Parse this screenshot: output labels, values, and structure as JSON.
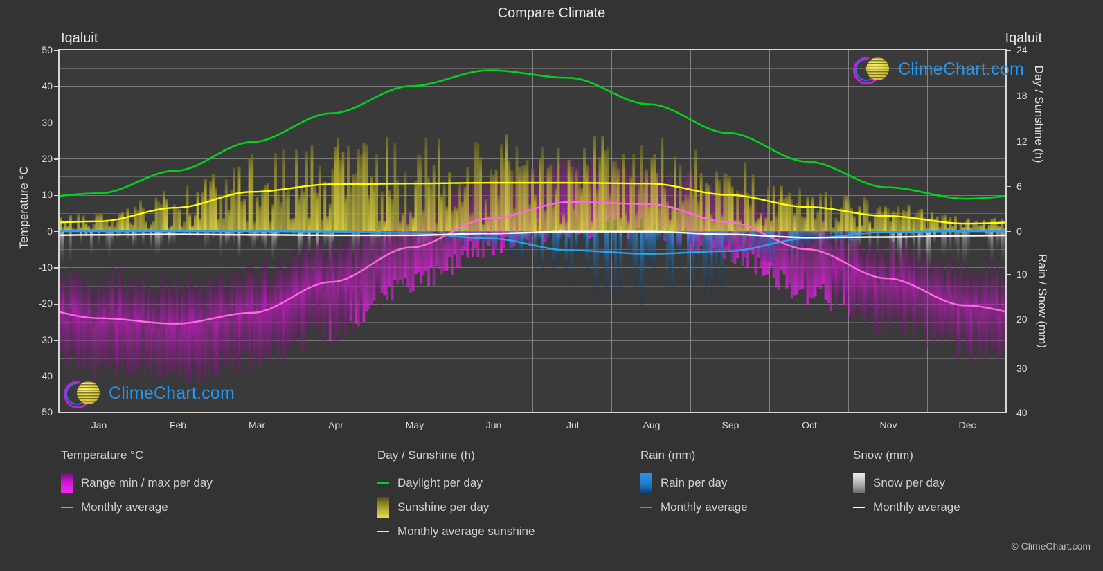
{
  "title": "Compare Climate",
  "city_left": "Iqaluit",
  "city_right": "Iqaluit",
  "logo_text": "ClimeChart.com",
  "copyright": "© ClimeChart.com",
  "axes": {
    "left_label": "Temperature °C",
    "right_label_top": "Day / Sunshine (h)",
    "right_label_bottom": "Rain / Snow (mm)",
    "left_ticks": [
      "50",
      "40",
      "30",
      "20",
      "10",
      "0",
      "-10",
      "-20",
      "-30",
      "-40",
      "-50"
    ],
    "right_ticks_top": [
      "24",
      "18",
      "12",
      "6",
      "0"
    ],
    "right_ticks_bottom": [
      "10",
      "20",
      "30",
      "40"
    ],
    "x_ticks": [
      "Jan",
      "Feb",
      "Mar",
      "Apr",
      "May",
      "Jun",
      "Jul",
      "Aug",
      "Sep",
      "Oct",
      "Nov",
      "Dec"
    ]
  },
  "colors": {
    "background": "#333333",
    "plot_background": "#3a3a3a",
    "grid": "#8d8d8d",
    "temperature_range": "#e000e0",
    "temperature_avg": "#ff6ae0",
    "daylight": "#00d21e",
    "sunshine_bars": "#d4cc33",
    "sunshine_avg": "#ffff00",
    "rain_bars": "#1a7fd4",
    "rain_avg": "#29a3f0",
    "snow_bars": "#bfbfbf",
    "snow_avg": "#ffffff",
    "logo_blue": "#2196f3"
  },
  "legend": {
    "temperature": {
      "heading": "Temperature °C",
      "items": [
        {
          "label": "Range min / max per day",
          "swatch": "gradient",
          "color": "#e000e0"
        },
        {
          "label": "Monthly average",
          "swatch": "line",
          "color": "#ff6ae0"
        }
      ]
    },
    "daysun": {
      "heading": "Day / Sunshine (h)",
      "items": [
        {
          "label": "Daylight per day",
          "swatch": "line",
          "color": "#00d21e"
        },
        {
          "label": "Sunshine per day",
          "swatch": "gradient",
          "color": "#d4cc33"
        },
        {
          "label": "Monthly average sunshine",
          "swatch": "line",
          "color": "#ffff00"
        }
      ]
    },
    "rain": {
      "heading": "Rain (mm)",
      "items": [
        {
          "label": "Rain per day",
          "swatch": "gradient",
          "color": "#1a7fd4"
        },
        {
          "label": "Monthly average",
          "swatch": "line",
          "color": "#29a3f0"
        }
      ]
    },
    "snow": {
      "heading": "Snow (mm)",
      "items": [
        {
          "label": "Snow per day",
          "swatch": "gradient",
          "color": "#bfbfbf"
        },
        {
          "label": "Monthly average",
          "swatch": "line",
          "color": "#ffffff"
        }
      ]
    }
  },
  "chart_data": {
    "type": "line",
    "title": "Compare Climate",
    "location": "Iqaluit",
    "xlabel": "",
    "ylabel": "Temperature °C",
    "ylim": [
      -50,
      50
    ],
    "y2lim_top": [
      0,
      24
    ],
    "y2lim_bottom": [
      0,
      40
    ],
    "grid": true,
    "legend_position": "bottom",
    "categories": [
      "Jan",
      "Feb",
      "Mar",
      "Apr",
      "May",
      "Jun",
      "Jul",
      "Aug",
      "Sep",
      "Oct",
      "Nov",
      "Dec"
    ],
    "series": [
      {
        "name": "Monthly average temperature (°C)",
        "color": "#ff6ae0",
        "unit": "°C",
        "values": [
          -24.0,
          -25.5,
          -22.5,
          -14.0,
          -4.5,
          3.5,
          8.0,
          7.5,
          2.5,
          -5.0,
          -13.0,
          -20.5
        ]
      },
      {
        "name": "Daily temperature range min/max (°C)",
        "color": "#e000e0",
        "unit": "°C",
        "min_values": [
          -38,
          -40,
          -36,
          -28,
          -14,
          -4,
          1,
          1,
          -6,
          -17,
          -26,
          -33
        ],
        "max_values": [
          -13,
          -15,
          -11,
          -3,
          5,
          13,
          17,
          16,
          10,
          2,
          -5,
          -10
        ]
      },
      {
        "name": "Daylight per day (h)",
        "color": "#00d21e",
        "unit": "h",
        "axis": "right-top",
        "values": [
          5.0,
          8.0,
          11.8,
          15.6,
          19.2,
          21.3,
          20.3,
          16.8,
          13.0,
          9.2,
          5.8,
          4.3
        ]
      },
      {
        "name": "Monthly average sunshine (h)",
        "color": "#ffff00",
        "unit": "h",
        "axis": "right-top",
        "values": [
          1.3,
          3.1,
          5.2,
          6.2,
          6.3,
          6.4,
          6.4,
          6.3,
          4.8,
          3.2,
          2.0,
          1.0
        ]
      },
      {
        "name": "Monthly average rain (mm)",
        "color": "#29a3f0",
        "unit": "mm",
        "axis": "right-bottom",
        "values": [
          0.0,
          0.0,
          0.0,
          0.1,
          0.4,
          1.6,
          4.2,
          5.0,
          4.4,
          1.6,
          0.2,
          0.0
        ]
      },
      {
        "name": "Monthly average snow (mm)",
        "color": "#ffffff",
        "unit": "mm",
        "axis": "right-bottom",
        "values": [
          0.8,
          0.7,
          0.8,
          0.9,
          0.9,
          0.5,
          0.1,
          0.1,
          0.7,
          1.4,
          1.3,
          1.0
        ]
      }
    ]
  }
}
